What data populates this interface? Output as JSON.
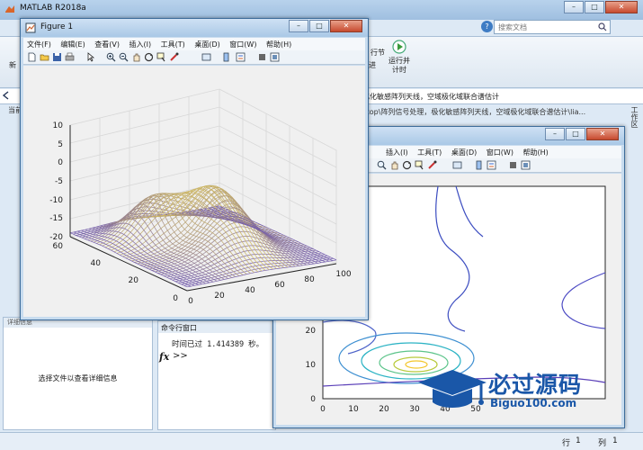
{
  "matlab": {
    "title": "MATLAB R2018a",
    "search_placeholder": "搜索文档",
    "ribbon": {
      "left_label": "新",
      "mid_label": "行节",
      "mid_label2": "进",
      "run_label": "运行并\n计时"
    },
    "path_text": "化化敏感阵列天线，空域极化域联合谱估计",
    "path_text2": "ktop\\阵列信号处理，极化敏感阵列天线，空域极化域联合谱估计\\lia...",
    "side_label": "当前",
    "detail_header": "详细信息",
    "detail_message": "选择文件以查看详细信息",
    "cmd_title": "命令行窗口",
    "cmd_output": "时间已过 1.414389 秒。",
    "cmd_prompt": ">>",
    "fx": "fx",
    "status": {
      "row_label": "行",
      "row_value": "1",
      "col_label": "列",
      "col_value": "1"
    },
    "vertical_tab": "工作区"
  },
  "figure1": {
    "title": "Figure 1",
    "menus": [
      "文件(F)",
      "编辑(E)",
      "查看(V)",
      "插入(I)",
      "工具(T)",
      "桌面(D)",
      "窗口(W)",
      "帮助(H)"
    ],
    "axes": {
      "z_ticks": [
        "10",
        "5",
        "0",
        "-5",
        "-10",
        "-15",
        "-20"
      ],
      "y_ticks": [
        "60",
        "40",
        "20",
        "0"
      ],
      "x_ticks": [
        "0",
        "20",
        "40",
        "60",
        "80",
        "100"
      ]
    }
  },
  "figure2": {
    "menus": [
      "插入(I)",
      "工具(T)",
      "桌面(D)",
      "窗口(W)",
      "帮助(H)"
    ],
    "axes": {
      "y_ticks": [
        "20",
        "10",
        "0"
      ],
      "x_ticks": [
        "0",
        "10",
        "20",
        "30",
        "40",
        "50"
      ]
    }
  },
  "watermark": {
    "big": "必过源码",
    "small": "Biguo100.com"
  }
}
